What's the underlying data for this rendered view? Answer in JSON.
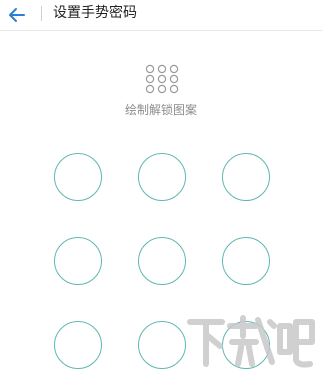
{
  "header": {
    "title": "设置手势密码",
    "back_icon": "arrow-left-icon",
    "accent": "#2a7fd4"
  },
  "indicator": {
    "icon": "nine-dot-grid-icon",
    "prompt": "绘制解锁图案"
  },
  "pattern": {
    "rows": 3,
    "cols": 3,
    "circle_color": "#5fb7b2"
  },
  "watermark": {
    "text": "下载吧",
    "color": "#bdbdbd"
  }
}
